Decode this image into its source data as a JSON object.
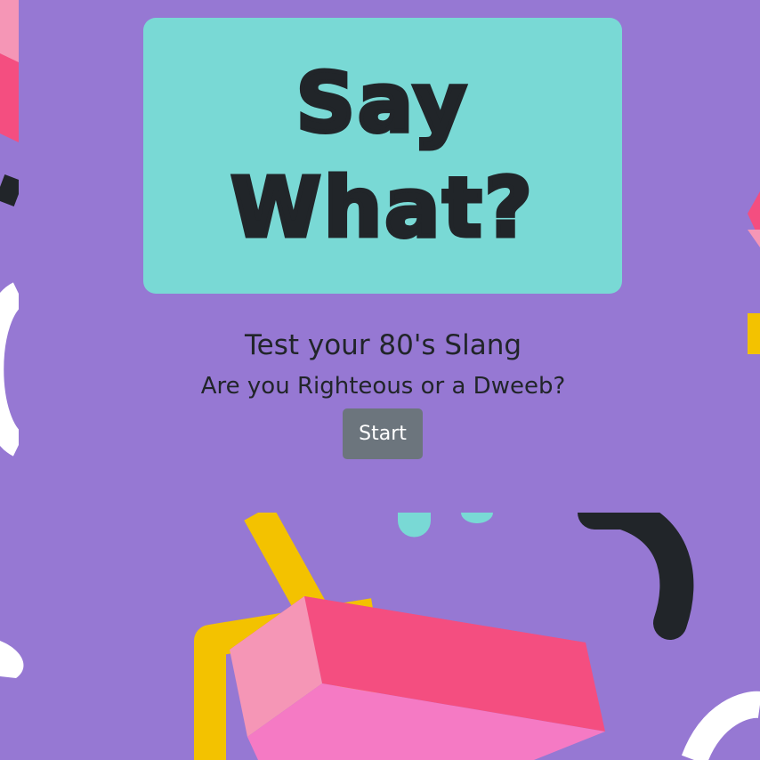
{
  "title": {
    "line1": "Say",
    "line2": "What?"
  },
  "subtitle": "Test your 80's Slang",
  "tagline": "Are you Righteous or a Dweeb?",
  "start_label": "Start",
  "colors": {
    "background": "#9678d3",
    "title_card": "#79d9d5",
    "text": "#212529",
    "button": "#6c757d",
    "button_text": "#ffffff",
    "accent_pink": "#f44e80",
    "accent_light_pink": "#f596b6",
    "accent_yellow": "#f3c200",
    "accent_white": "#ffffff"
  }
}
